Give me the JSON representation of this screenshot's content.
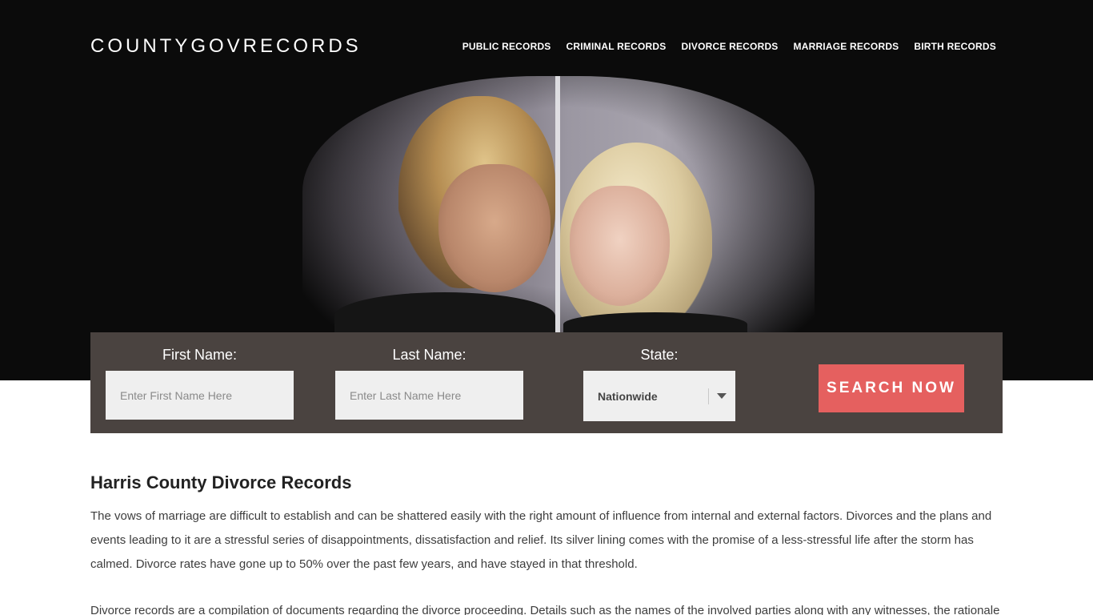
{
  "site": {
    "logo": "COUNTYGOVRECORDS"
  },
  "nav": {
    "items": [
      {
        "label": "PUBLIC RECORDS"
      },
      {
        "label": "CRIMINAL RECORDS"
      },
      {
        "label": "DIVORCE RECORDS"
      },
      {
        "label": "MARRIAGE RECORDS"
      },
      {
        "label": "BIRTH RECORDS"
      }
    ]
  },
  "search": {
    "first_name_label": "First Name:",
    "first_name_placeholder": "Enter First Name Here",
    "first_name_value": "",
    "last_name_label": "Last Name:",
    "last_name_placeholder": "Enter Last Name Here",
    "last_name_value": "",
    "state_label": "State:",
    "state_value": "Nationwide",
    "button_label": "SEARCH NOW"
  },
  "main": {
    "title": "Harris County Divorce Records",
    "paragraphs": [
      "The vows of marriage are difficult to establish and can be shattered easily with the right amount of influence from internal and external factors. Divorces and the plans and events leading to it are a stressful series of disappointments, dissatisfaction and relief. Its silver lining comes with the promise of a less-stressful life after the storm has calmed. Divorce rates have gone up to 50% over the past few years, and have stayed in that threshold.",
      "Divorce records are a compilation of documents regarding the divorce proceeding. Details such as the names of the involved parties along with any witnesses, the rationale"
    ]
  },
  "colors": {
    "hero_bg": "#0b0b0b",
    "panel_bg": "#4a4340",
    "accent": "#e5605f"
  }
}
